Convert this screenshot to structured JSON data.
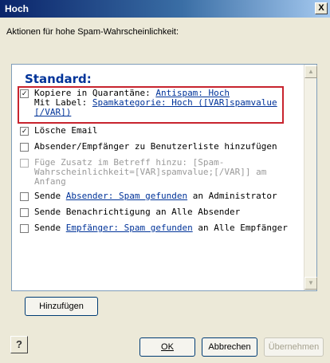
{
  "window": {
    "title": "Hoch",
    "close_label": "X"
  },
  "group_label": "Aktionen für hohe Spam-Wahrscheinlichkeit:",
  "list": {
    "header": "Standard:",
    "items": [
      {
        "checked": true,
        "part1": "Kopiere in Quarantäne: ",
        "link1": "Antispam: Hoch",
        "part2": "Mit Label: ",
        "link2": "Spamkategorie: Hoch ([VAR]spamvalue [/VAR])"
      },
      {
        "checked": true,
        "text": "Lösche Email"
      },
      {
        "checked": false,
        "text": "Absender/Empfänger zu Benutzerliste hinzufügen"
      },
      {
        "checked": false,
        "disabled": true,
        "text": "Füge Zusatz im Betreff hinzu: [Spam-Wahrscheinlichkeit=[VAR]spamvalue;[/VAR]] am Anfang"
      },
      {
        "checked": false,
        "part1": "Sende ",
        "link1": "Absender: Spam gefunden",
        "part2": " an Administrator"
      },
      {
        "checked": false,
        "text": "Sende Benachrichtigung an Alle Absender"
      },
      {
        "checked": false,
        "part1": "Sende ",
        "link1": "Empfänger: Spam gefunden",
        "part2": " an Alle Empfänger"
      }
    ]
  },
  "buttons": {
    "add": "Hinzufügen",
    "ok": "OK",
    "cancel": "Abbrechen",
    "apply": "Übernehmen"
  },
  "check_mark": "✓",
  "colors": {
    "highlight": "#c8242e",
    "link": "#003399"
  }
}
